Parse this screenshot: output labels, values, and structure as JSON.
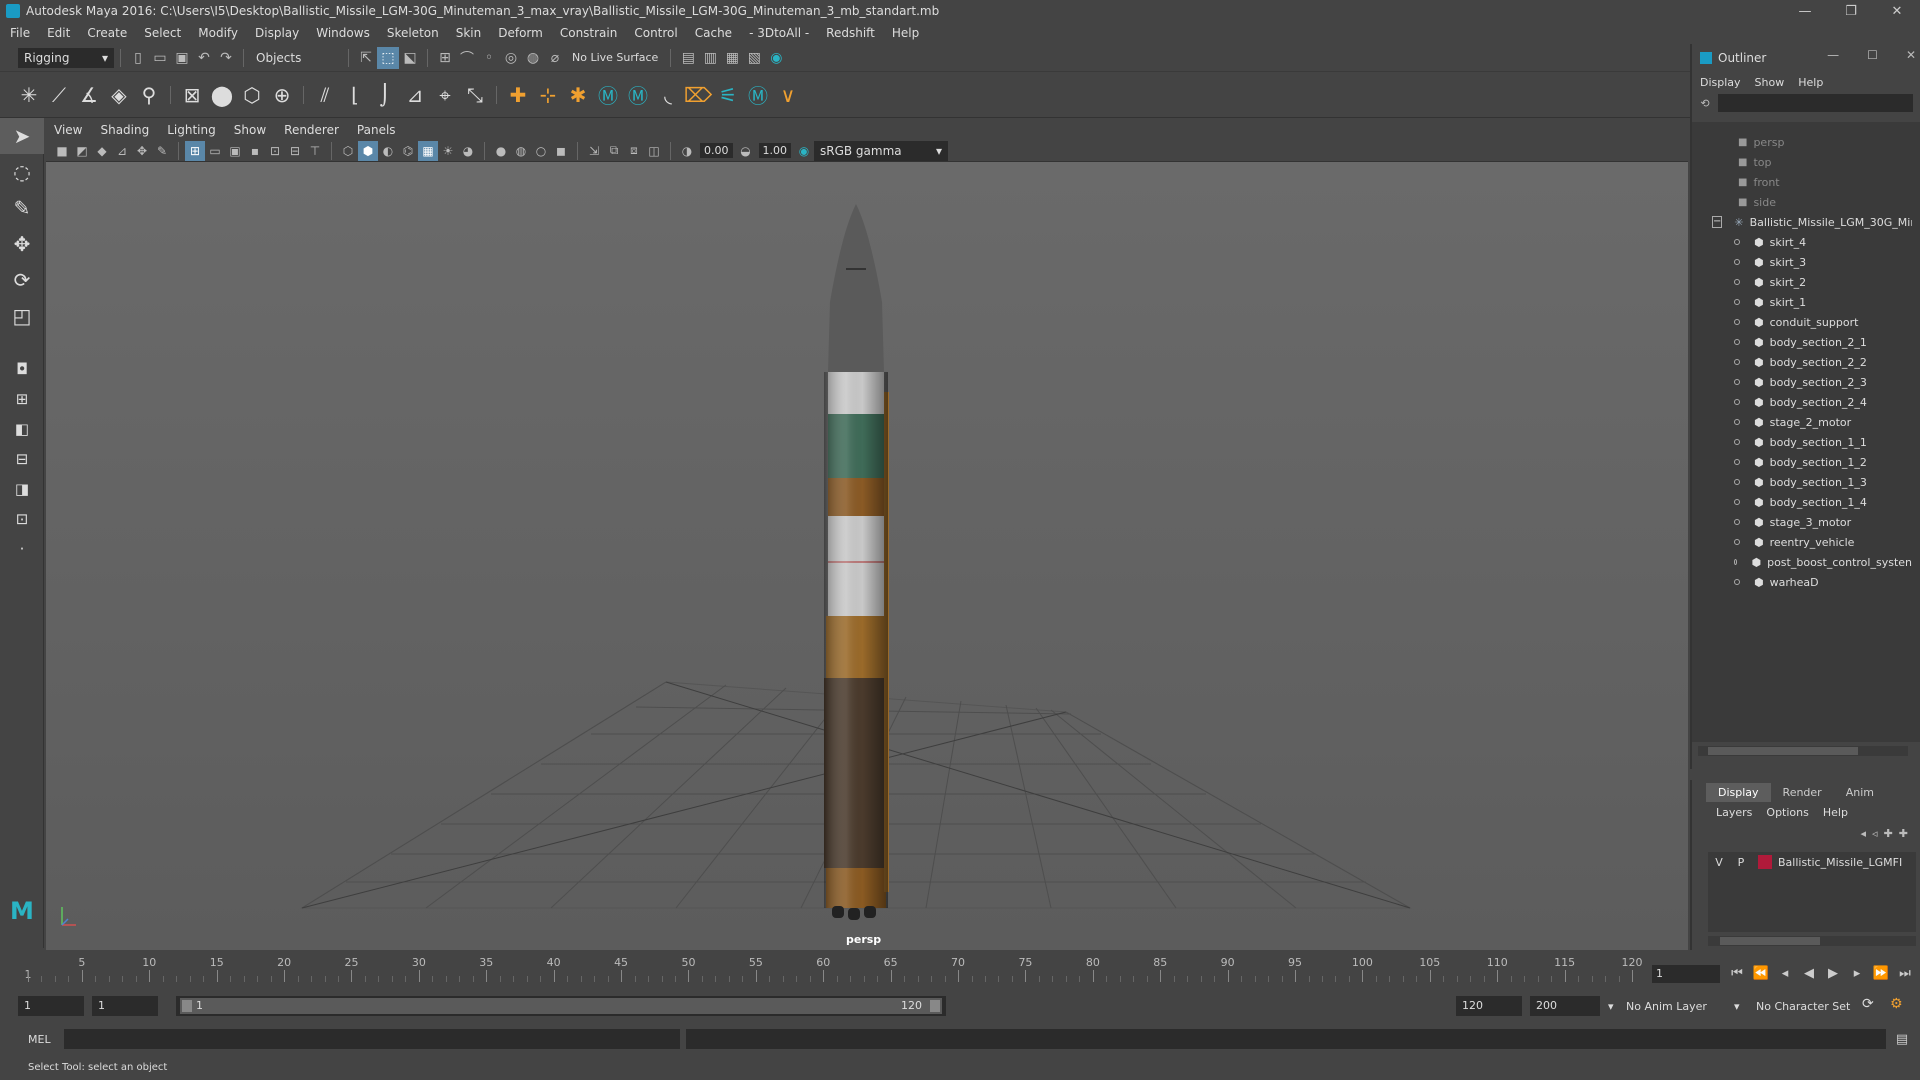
{
  "window": {
    "title": "Autodesk Maya 2016: C:\\Users\\I5\\Desktop\\Ballistic_Missile_LGM-30G_Minuteman_3_max_vray\\Ballistic_Missile_LGM-30G_Minuteman_3_mb_standart.mb",
    "minimize": "—",
    "restore": "❐",
    "close": "✕"
  },
  "menubar": [
    "File",
    "Edit",
    "Create",
    "Select",
    "Modify",
    "Display",
    "Windows",
    "Skeleton",
    "Skin",
    "Deform",
    "Constrain",
    "Control",
    "Cache",
    "- 3DtoAll -",
    "Redshift",
    "Help"
  ],
  "statusline": {
    "menuset": "Rigging",
    "selection_mask": "Objects",
    "live_surface": "No Live Surface"
  },
  "viewport": {
    "menu": [
      "View",
      "Shading",
      "Lighting",
      "Show",
      "Renderer",
      "Panels"
    ],
    "exposure": "0.00",
    "gamma": "1.00",
    "color_space": "sRGB gamma",
    "camera_label": "persp"
  },
  "outliner": {
    "title": "Outliner",
    "menu": [
      "Display",
      "Show",
      "Help"
    ],
    "cameras": [
      "persp",
      "top",
      "front",
      "side"
    ],
    "root": "Ballistic_Missile_LGM_30G_Min",
    "children": [
      "skirt_4",
      "skirt_3",
      "skirt_2",
      "skirt_1",
      "conduit_support",
      "body_section_2_1",
      "body_section_2_2",
      "body_section_2_3",
      "body_section_2_4",
      "stage_2_motor",
      "body_section_1_1",
      "body_section_1_2",
      "body_section_1_3",
      "body_section_1_4",
      "stage_3_motor",
      "reentry_vehicle",
      "post_boost_control_systen",
      "warheaD"
    ]
  },
  "layer_editor": {
    "tabs": [
      "Display",
      "Render",
      "Anim"
    ],
    "menu": [
      "Layers",
      "Options",
      "Help"
    ],
    "layer": {
      "v": "V",
      "p": "P",
      "name": "Ballistic_Missile_LGMFI",
      "color": "#b01a3a"
    }
  },
  "timeline": {
    "ticks": [
      "1",
      "5",
      "10",
      "15",
      "20",
      "25",
      "30",
      "35",
      "40",
      "45",
      "50",
      "55",
      "60",
      "65",
      "70",
      "75",
      "80",
      "85",
      "90",
      "95",
      "100",
      "105",
      "110",
      "115",
      "120"
    ],
    "current_frame": "1"
  },
  "range": {
    "start": "1",
    "playback_start": "1",
    "slider_start": "1",
    "slider_end": "120",
    "playback_end": "120",
    "end": "200",
    "anim_layer": "No Anim Layer",
    "character_set": "No Character Set"
  },
  "command_line": {
    "label": "MEL"
  },
  "help_line": "Select Tool: select an object",
  "colors": {
    "accent": "#1a9bc4",
    "shelf_orange": "#f0a030",
    "layer_swatch": "#b01a3a"
  }
}
